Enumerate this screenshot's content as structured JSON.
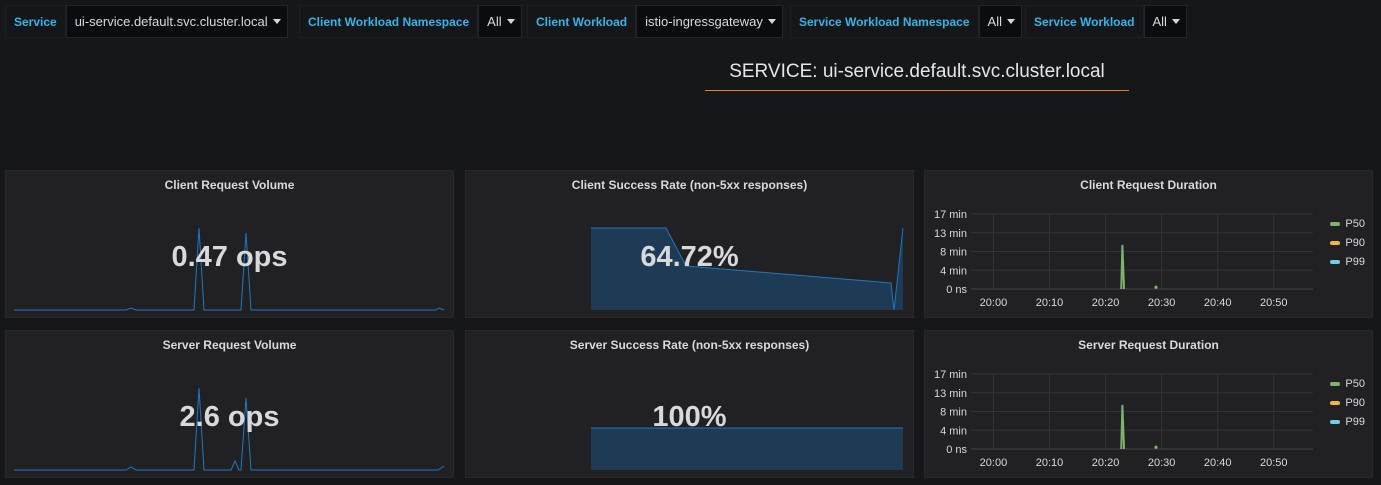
{
  "variables": [
    {
      "label": "Service",
      "value": "ui-service.default.svc.cluster.local"
    },
    {
      "label": "Client Workload Namespace",
      "value": "All"
    },
    {
      "label": "Client Workload",
      "value": "istio-ingressgateway"
    },
    {
      "label": "Service Workload Namespace",
      "value": "All"
    },
    {
      "label": "Service Workload",
      "value": "All"
    }
  ],
  "header": {
    "title": "SERVICE: ui-service.default.svc.cluster.local"
  },
  "colors": {
    "accent": "#33b5e5",
    "underline": "#eb7b18",
    "spark": "#1f78c1",
    "p50": "#7eb26d",
    "p90": "#eab839",
    "p99": "#6ed0e0"
  },
  "panels": {
    "client_volume": {
      "title": "Client Request Volume",
      "value": "0.47 ops"
    },
    "client_success": {
      "title": "Client Success Rate (non-5xx responses)",
      "value": "64.72%"
    },
    "client_duration": {
      "title": "Client Request Duration"
    },
    "server_volume": {
      "title": "Server Request Volume",
      "value": "2.6 ops"
    },
    "server_success": {
      "title": "Server Success Rate (non-5xx responses)",
      "value": "100%"
    },
    "server_duration": {
      "title": "Server Request Duration"
    }
  },
  "legend": [
    "P50",
    "P90",
    "P99"
  ],
  "chart_data": [
    {
      "type": "line",
      "title": "Client Request Duration",
      "x": [
        "20:00",
        "20:10",
        "20:20",
        "20:30",
        "20:40",
        "20:50"
      ],
      "ytick_labels": [
        "17 min",
        "13 min",
        "8 min",
        "4 min",
        "0 ns"
      ],
      "ylim_minutes": [
        0,
        17
      ],
      "grid": true,
      "legend_placement": "right",
      "series": [
        {
          "name": "P50",
          "color": "#7eb26d",
          "points": [
            [
              22.8,
              0
            ],
            [
              23.0,
              10
            ],
            [
              23.3,
              0
            ],
            [
              29.0,
              0.4
            ]
          ]
        },
        {
          "name": "P90",
          "color": "#eab839",
          "points": []
        },
        {
          "name": "P99",
          "color": "#6ed0e0",
          "points": []
        }
      ]
    },
    {
      "type": "line",
      "title": "Server Request Duration",
      "x": [
        "20:00",
        "20:10",
        "20:20",
        "20:30",
        "20:40",
        "20:50"
      ],
      "ytick_labels": [
        "17 min",
        "13 min",
        "8 min",
        "4 min",
        "0 ns"
      ],
      "ylim_minutes": [
        0,
        17
      ],
      "grid": true,
      "legend_placement": "right",
      "series": [
        {
          "name": "P50",
          "color": "#7eb26d",
          "points": [
            [
              22.8,
              0
            ],
            [
              23.0,
              10
            ],
            [
              23.3,
              0
            ],
            [
              29.0,
              0.4
            ]
          ]
        },
        {
          "name": "P90",
          "color": "#eab839",
          "points": []
        },
        {
          "name": "P99",
          "color": "#6ed0e0",
          "points": []
        }
      ]
    }
  ]
}
